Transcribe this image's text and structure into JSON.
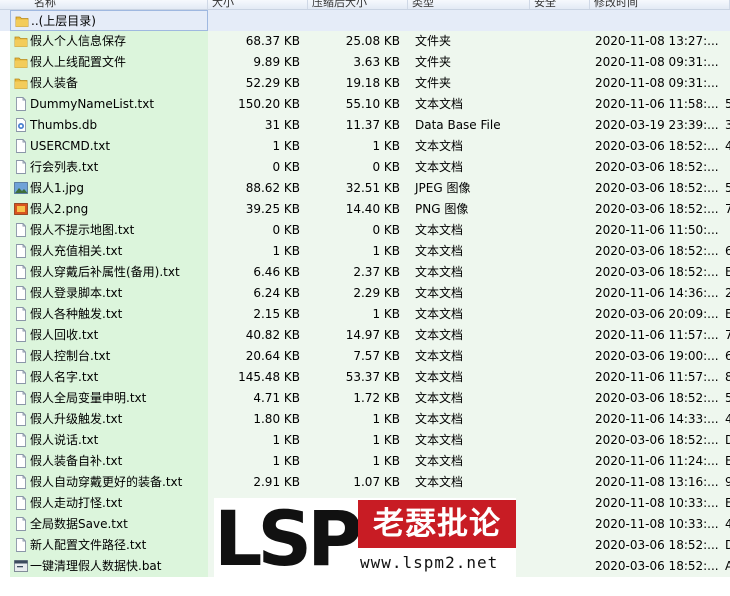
{
  "columns": [
    "名称",
    "大小",
    "压缩后大小",
    "类型",
    "安全",
    "修改时间"
  ],
  "rows": [
    {
      "icon": "folder-icon",
      "name": "..(上层目录)",
      "size": "",
      "packed": "",
      "type": "",
      "time": "",
      "extra": "",
      "up": true
    },
    {
      "icon": "folder-icon",
      "name": "假人个人信息保存",
      "size": "68.37 KB",
      "packed": "25.08 KB",
      "type": "文件夹",
      "time": "2020-11-08 13:27:...",
      "extra": ""
    },
    {
      "icon": "folder-icon",
      "name": "假人上线配置文件",
      "size": "9.89 KB",
      "packed": "3.63 KB",
      "type": "文件夹",
      "time": "2020-11-08 09:31:...",
      "extra": ""
    },
    {
      "icon": "folder-icon",
      "name": "假人装备",
      "size": "52.29 KB",
      "packed": "19.18 KB",
      "type": "文件夹",
      "time": "2020-11-08 09:31:...",
      "extra": ""
    },
    {
      "icon": "text-file-icon",
      "name": "DummyNameList.txt",
      "size": "150.20 KB",
      "packed": "55.10 KB",
      "type": "文本文档",
      "time": "2020-11-06 11:58:...",
      "extra": "5"
    },
    {
      "icon": "db-file-icon",
      "name": "Thumbs.db",
      "size": "31 KB",
      "packed": "11.37 KB",
      "type": "Data Base File",
      "time": "2020-03-19 23:39:...",
      "extra": "3"
    },
    {
      "icon": "text-file-icon",
      "name": "USERCMD.txt",
      "size": "1 KB",
      "packed": "1 KB",
      "type": "文本文档",
      "time": "2020-03-06 18:52:...",
      "extra": "4"
    },
    {
      "icon": "text-file-icon",
      "name": "行会列表.txt",
      "size": "0 KB",
      "packed": "0 KB",
      "type": "文本文档",
      "time": "2020-03-06 18:52:...",
      "extra": ""
    },
    {
      "icon": "jpg-file-icon",
      "name": "假人1.jpg",
      "size": "88.62 KB",
      "packed": "32.51 KB",
      "type": "JPEG 图像",
      "time": "2020-03-06 18:52:...",
      "extra": "5"
    },
    {
      "icon": "png-file-icon",
      "name": "假人2.png",
      "size": "39.25 KB",
      "packed": "14.40 KB",
      "type": "PNG 图像",
      "time": "2020-03-06 18:52:...",
      "extra": "7"
    },
    {
      "icon": "text-file-icon",
      "name": "假人不提示地图.txt",
      "size": "0 KB",
      "packed": "0 KB",
      "type": "文本文档",
      "time": "2020-11-06 11:50:...",
      "extra": ""
    },
    {
      "icon": "text-file-icon",
      "name": "假人充值相关.txt",
      "size": "1 KB",
      "packed": "1 KB",
      "type": "文本文档",
      "time": "2020-03-06 18:52:...",
      "extra": "6"
    },
    {
      "icon": "text-file-icon",
      "name": "假人穿戴后补属性(备用).txt",
      "size": "6.46 KB",
      "packed": "2.37 KB",
      "type": "文本文档",
      "time": "2020-03-06 18:52:...",
      "extra": "E"
    },
    {
      "icon": "text-file-icon",
      "name": "假人登录脚本.txt",
      "size": "6.24 KB",
      "packed": "2.29 KB",
      "type": "文本文档",
      "time": "2020-11-06 14:36:...",
      "extra": "2"
    },
    {
      "icon": "text-file-icon",
      "name": "假人各种触发.txt",
      "size": "2.15 KB",
      "packed": "1 KB",
      "type": "文本文档",
      "time": "2020-03-06 20:09:...",
      "extra": "E"
    },
    {
      "icon": "text-file-icon",
      "name": "假人回收.txt",
      "size": "40.82 KB",
      "packed": "14.97 KB",
      "type": "文本文档",
      "time": "2020-11-06 11:57:...",
      "extra": "7"
    },
    {
      "icon": "text-file-icon",
      "name": "假人控制台.txt",
      "size": "20.64 KB",
      "packed": "7.57 KB",
      "type": "文本文档",
      "time": "2020-03-06 19:00:...",
      "extra": "6"
    },
    {
      "icon": "text-file-icon",
      "name": "假人名字.txt",
      "size": "145.48 KB",
      "packed": "53.37 KB",
      "type": "文本文档",
      "time": "2020-11-06 11:57:...",
      "extra": "8"
    },
    {
      "icon": "text-file-icon",
      "name": "假人全局变量申明.txt",
      "size": "4.71 KB",
      "packed": "1.72 KB",
      "type": "文本文档",
      "time": "2020-03-06 18:52:...",
      "extra": "5"
    },
    {
      "icon": "text-file-icon",
      "name": "假人升级触发.txt",
      "size": "1.80 KB",
      "packed": "1 KB",
      "type": "文本文档",
      "time": "2020-11-06 14:33:...",
      "extra": "4"
    },
    {
      "icon": "text-file-icon",
      "name": "假人说话.txt",
      "size": "1 KB",
      "packed": "1 KB",
      "type": "文本文档",
      "time": "2020-03-06 18:52:...",
      "extra": "D"
    },
    {
      "icon": "text-file-icon",
      "name": "假人装备自补.txt",
      "size": "1 KB",
      "packed": "1 KB",
      "type": "文本文档",
      "time": "2020-11-06 11:24:...",
      "extra": "E"
    },
    {
      "icon": "text-file-icon",
      "name": "假人自动穿戴更好的装备.txt",
      "size": "2.91 KB",
      "packed": "1.07 KB",
      "type": "文本文档",
      "time": "2020-11-08 13:16:...",
      "extra": "9"
    },
    {
      "icon": "text-file-icon",
      "name": "假人走动打怪.txt",
      "size": "",
      "packed": "",
      "type": "",
      "time": "2020-11-08 10:33:...",
      "extra": "E"
    },
    {
      "icon": "text-file-icon",
      "name": "全局数据Save.txt",
      "size": "",
      "packed": "",
      "type": "",
      "time": "2020-11-08 10:33:...",
      "extra": "4"
    },
    {
      "icon": "text-file-icon",
      "name": "新人配置文件路径.txt",
      "size": "",
      "packed": "",
      "type": "",
      "time": "2020-03-06 18:52:...",
      "extra": "D"
    },
    {
      "icon": "bat-file-icon",
      "name": "一键清理假人数据快.bat",
      "size": "",
      "packed": "",
      "type": "",
      "time": "2020-03-06 18:52:...",
      "extra": "A"
    }
  ],
  "watermark": {
    "logo": "LSP",
    "cn": "老瑟批论坛",
    "url": "www.lspm2.net"
  }
}
